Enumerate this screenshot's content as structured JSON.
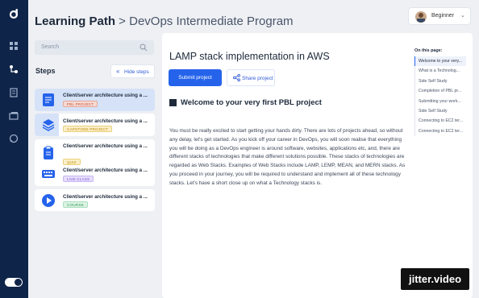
{
  "header": {
    "title_main": "Learning Path",
    "title_sub": " > DevOps Intermediate Program",
    "user_level": "Beginner",
    "chevron": "⌄"
  },
  "search": {
    "placeholder": "Search"
  },
  "steps": {
    "label": "Steps",
    "hide_label": "Hide steps",
    "hide_icon": "«",
    "items": [
      {
        "name": "Client/server architecture using a ...",
        "badge": "PBL PROJECT",
        "icon": "document-icon"
      },
      {
        "name": "Client/server architecture using a ...",
        "badge": "CAPSTONE PROJECT",
        "icon": "layers-icon"
      },
      {
        "name": "Client/server architecture using a ...",
        "badge": "QUIZ",
        "icon": "clipboard-icon"
      },
      {
        "name": "Client/server architecture using a ...",
        "badge": "LIVE CLASS",
        "icon": "keyboard-icon"
      },
      {
        "name": "Client/server architecture using a ...",
        "badge": "COURSE",
        "icon": "play-icon"
      }
    ]
  },
  "main": {
    "title": "LAMP stack implementation in AWS",
    "submit_label": "Submit project",
    "share_label": "Share project",
    "section_title": "Welcome to your very first PBL project",
    "paragraph": "You must be really excited to start getting your hands dirty. There are lots of projects ahead, so without any delay, let's get started. As you kick off your career in DevOps, you will soon realise that everything you will be doing as a DevOps engineer is around software, websites, applications etc, and, there are different stacks of technologies that make different solutions possible. These stacks of technologies are regarded as Web Stacks. Examples of Web Stacks include LAMP, LEMP, MEAN, and MERN stacks. As you proceed in your journey, you will be required to understand and implement all of these technology stacks. Let's have a short close up on what a Technology stacks is."
  },
  "toc": {
    "heading": "On this page:",
    "items": [
      "Welcome to your very...",
      "What is a Technolog...",
      "Side Self Study",
      "Completion of PBL pr...",
      "Submitting your work...",
      "Side Self Study",
      "Connecting to EC2 ter...",
      "Connecting to EC2 ter..."
    ]
  },
  "watermark": "jitter.video",
  "colors": {
    "sidebar": "#0f2449",
    "accent": "#2563eb",
    "active_card": "#d6e2f7"
  }
}
